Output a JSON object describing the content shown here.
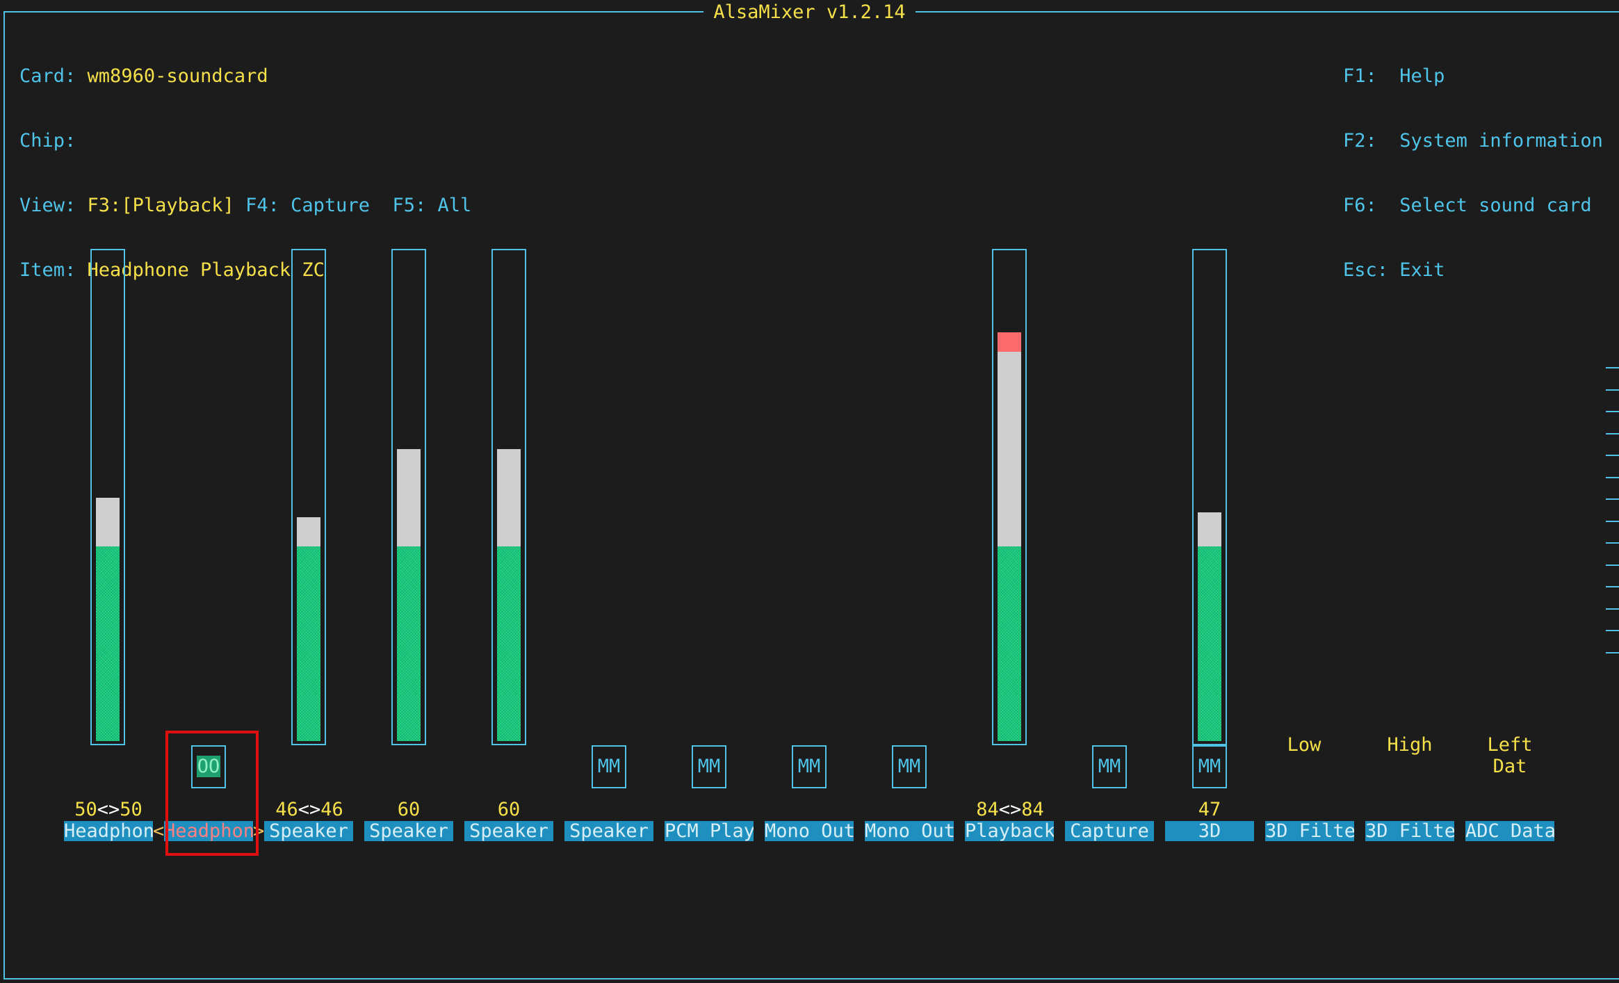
{
  "window": {
    "title": "AlsaMixer v1.2.14"
  },
  "info": {
    "card_label": "Card:",
    "card_value": "wm8960-soundcard",
    "chip_label": "Chip:",
    "chip_value": "",
    "view_label": "View:",
    "view_f3": "F3:[Playback]",
    "view_f4": "F4: Capture",
    "view_f5": "F5: All",
    "item_label": "Item:",
    "item_value": "Headphone Playback ZC"
  },
  "keys": [
    {
      "key": "F1:",
      "desc": "Help"
    },
    {
      "key": "F2:",
      "desc": "System information"
    },
    {
      "key": "F6:",
      "desc": "Select sound card"
    },
    {
      "key": "Esc:",
      "desc": "Exit"
    }
  ],
  "controls": [
    {
      "name": "Headphon",
      "volume_left": "50",
      "volume_right": "50",
      "level": 50
    },
    {
      "name": "Headphon",
      "switch": "OO",
      "selected": true
    },
    {
      "name": "Speaker",
      "volume_left": "46",
      "volume_right": "46",
      "level": 46
    },
    {
      "name": "Speaker",
      "volume": "60",
      "level": 60
    },
    {
      "name": "Speaker",
      "volume": "60",
      "level": 60
    },
    {
      "name": "Speaker",
      "switch": "MM"
    },
    {
      "name": "PCM Play",
      "switch": "MM"
    },
    {
      "name": "Mono Out",
      "switch": "MM"
    },
    {
      "name": "Mono Out",
      "switch": "MM"
    },
    {
      "name": "Playback",
      "volume_left": "84",
      "volume_right": "84",
      "level": 84
    },
    {
      "name": "Capture",
      "switch": "MM"
    },
    {
      "name": "3D",
      "volume": "47",
      "level": 47,
      "switch": "MM"
    },
    {
      "name": "3D Filte",
      "enum_value": "Low"
    },
    {
      "name": "3D Filte",
      "enum_value": "High"
    },
    {
      "name": "ADC Data",
      "enum_value": "Left Dat"
    }
  ],
  "selection": {
    "left_arrow": "<",
    "right_arrow": ">"
  },
  "colors": {
    "border": "#4fc3e8",
    "accent": "#f5e04a",
    "level_low": "#16c97a",
    "level_mid": "#cfcfcf",
    "level_high": "#ff6a6a",
    "label_bg": "#1f8fbf",
    "selection_box": "#e01010"
  }
}
